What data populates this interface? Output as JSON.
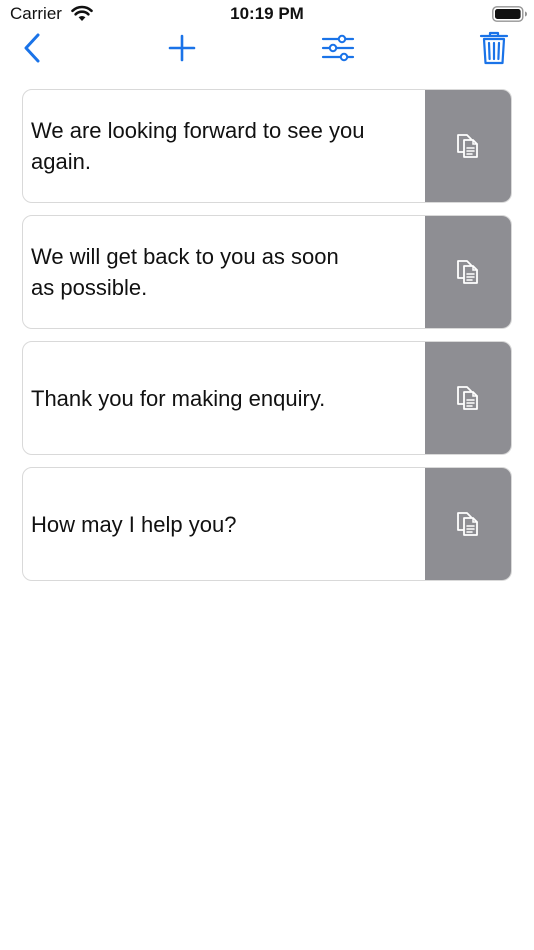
{
  "status_bar": {
    "carrier": "Carrier",
    "time": "10:19 PM",
    "wifi_icon": "wifi-icon",
    "battery_icon": "battery-icon"
  },
  "toolbar": {
    "back_icon": "chevron-left-icon",
    "add_icon": "plus-icon",
    "filter_icon": "sliders-icon",
    "trash_icon": "trash-icon",
    "accent_color": "#1a73e8"
  },
  "messages": [
    {
      "text": "We are looking forward to see you again.",
      "action_icon": "copy-icon"
    },
    {
      "text": "We will get back to you as soon as possible.",
      "action_icon": "copy-icon"
    },
    {
      "text": "Thank you for making enquiry.",
      "action_icon": "copy-icon"
    },
    {
      "text": "How may I help you?",
      "action_icon": "copy-icon"
    }
  ],
  "colors": {
    "action_background": "#8e8e93",
    "card_border": "#d9d9d9"
  }
}
